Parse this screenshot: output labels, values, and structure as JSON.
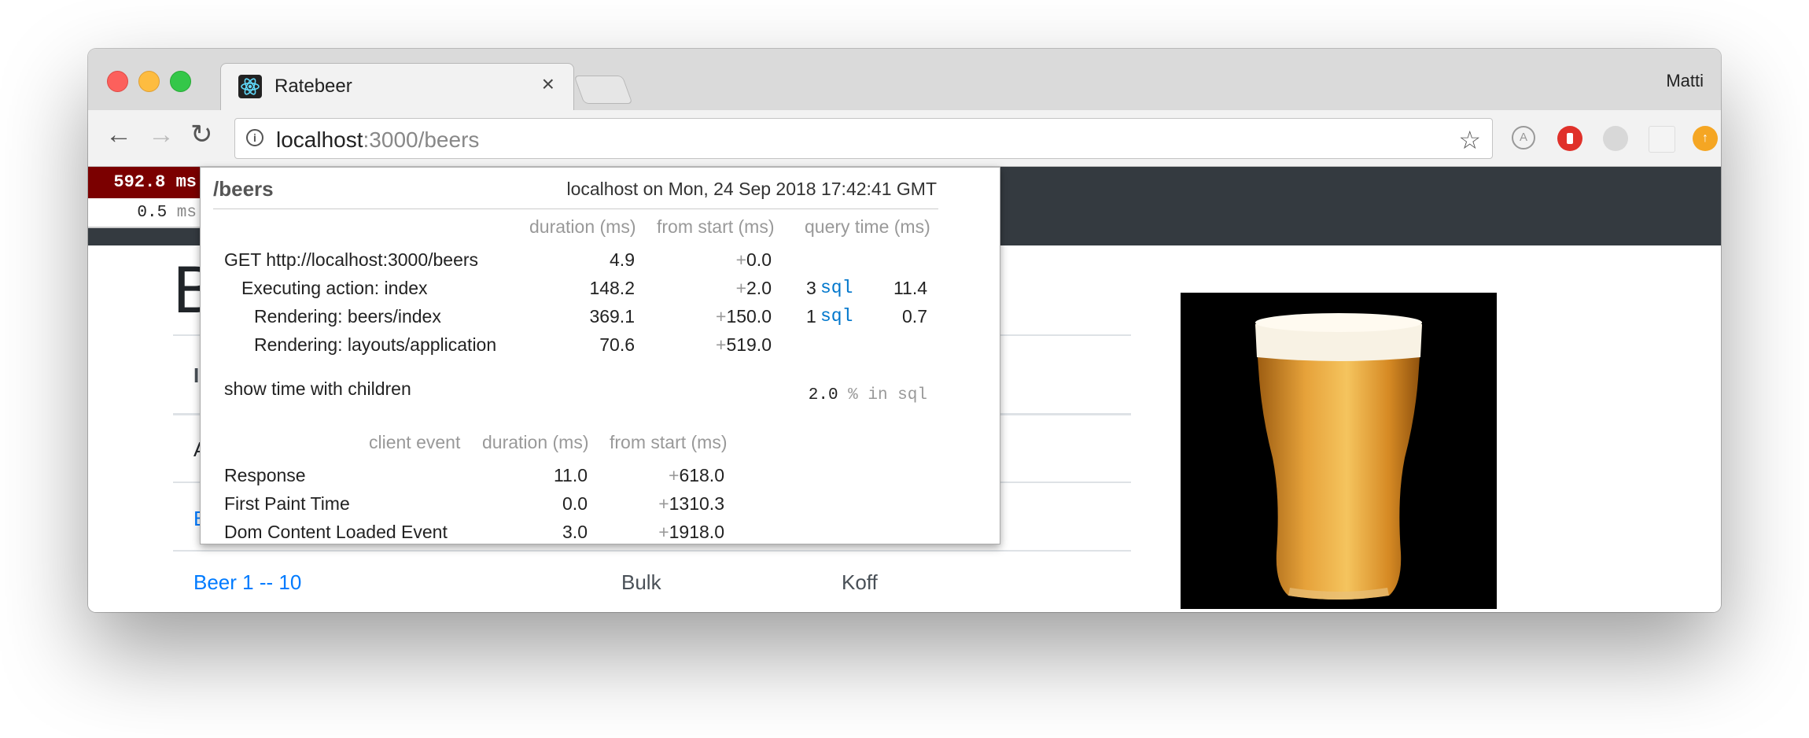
{
  "browser": {
    "tab_title": "Ratebeer",
    "tab_close": "×",
    "profile_name": "Matti",
    "url_host": "localhost",
    "url_rest": ":3000/beers",
    "back_icon": "←",
    "forward_icon": "→",
    "reload_icon": "↻",
    "star_icon": "☆"
  },
  "page": {
    "heading": "B",
    "row_labels": [
      "I",
      "A",
      "B"
    ],
    "last_row": {
      "name": "Beer 1 -- 10",
      "style": "Bulk",
      "brewery": "Koff"
    }
  },
  "profiler": {
    "total": "592.8",
    "total_unit": "ms",
    "small": "0.5",
    "small_unit": "ms",
    "path": "/beers",
    "host_info": "localhost on Mon, 24 Sep 2018 17:42:41 GMT",
    "headers": {
      "duration": "duration (ms)",
      "from_start": "from start (ms)",
      "query_time": "query time (ms)"
    },
    "timings": [
      {
        "label": "GET http://localhost:3000/beers",
        "duration": "4.9",
        "plus": "+",
        "start": "0.0",
        "sql_count": "",
        "sql": "",
        "query": ""
      },
      {
        "label": "Executing action: index",
        "duration": "148.2",
        "plus": "+",
        "start": "2.0",
        "sql_count": "3",
        "sql": "sql",
        "query": "11.4"
      },
      {
        "label": "Rendering: beers/index",
        "duration": "369.1",
        "plus": "+",
        "start": "150.0",
        "sql_count": "1",
        "sql": "sql",
        "query": "0.7"
      },
      {
        "label": "Rendering: layouts/application",
        "duration": "70.6",
        "plus": "+",
        "start": "519.0",
        "sql_count": "",
        "sql": "",
        "query": ""
      }
    ],
    "show_children": "show time with children",
    "sql_percent": "2.0",
    "sql_percent_label": "% in sql",
    "client_headers": {
      "event": "client event",
      "duration": "duration (ms)",
      "from_start": "from start (ms)"
    },
    "client_events": [
      {
        "label": "Response",
        "duration": "11.0",
        "plus": "+",
        "start": "618.0"
      },
      {
        "label": "First Paint Time",
        "duration": "0.0",
        "plus": "+",
        "start": "1310.3"
      },
      {
        "label": "Dom Content Loaded Event",
        "duration": "3.0",
        "plus": "+",
        "start": "1918.0"
      }
    ]
  },
  "colors": {
    "profiler_badge": "#7b0000",
    "navbar": "#343a40",
    "link": "#007bff"
  }
}
